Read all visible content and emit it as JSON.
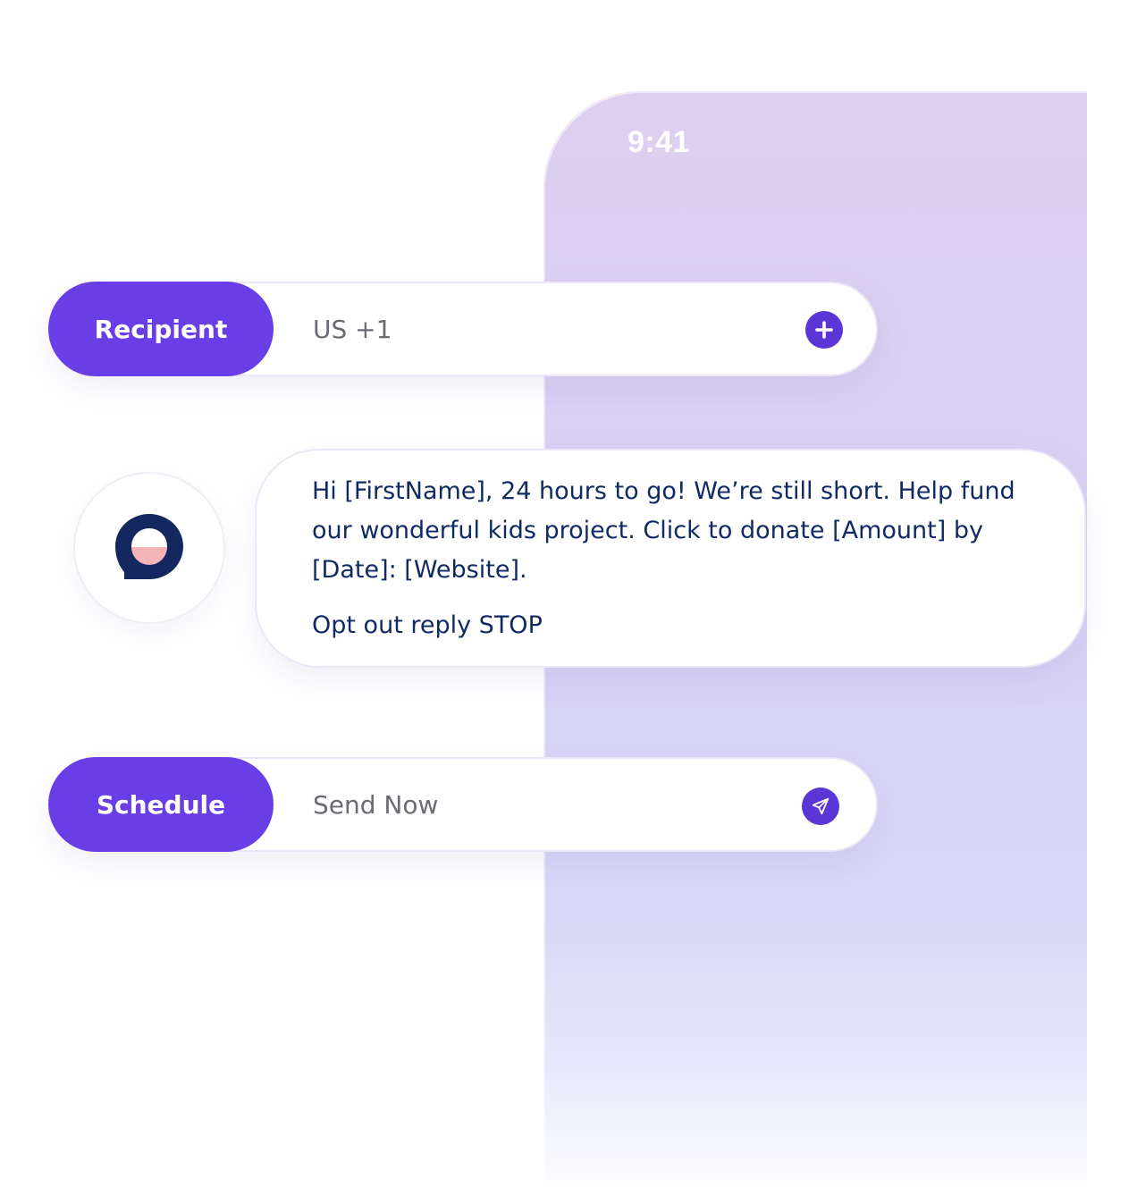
{
  "status_bar": {
    "time": "9:41"
  },
  "recipient": {
    "label": "Recipient",
    "value": "US +1",
    "action_icon": "plus-icon"
  },
  "message": {
    "avatar_icon": "chat-bubble-logo-icon",
    "body": "Hi [FirstName], 24 hours to go! We’re still short. Help fund our wonderful kids project. Click to donate [Amount] by [Date]: [Website].",
    "opt_out": "Opt out reply STOP"
  },
  "schedule": {
    "label": "Schedule",
    "value": "Send Now",
    "action_icon": "send-icon"
  },
  "colors": {
    "accent": "#6a3ee6",
    "icon_bg": "#5b35d6",
    "message_text": "#102a63",
    "phone_bg": "#dccff0",
    "logo_navy": "#14285f",
    "logo_pink": "#f5b5b8"
  }
}
